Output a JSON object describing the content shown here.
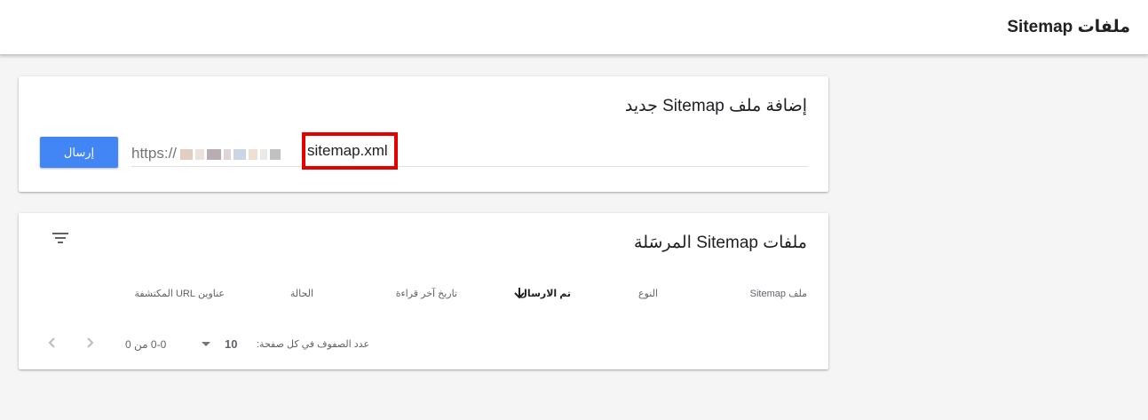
{
  "header": {
    "title": "ملفات Sitemap"
  },
  "add_sitemap": {
    "title": "إضافة ملف Sitemap جديد",
    "url_prefix": "https://",
    "input_value": "sitemap.xml",
    "submit_label": "إرسال"
  },
  "submitted": {
    "title": "ملفات Sitemap المرسَلة",
    "columns": {
      "sitemap": "ملف Sitemap",
      "type": "النوع",
      "submitted": "تم الارسال",
      "last_read": "تاريخ آخر قراءة",
      "status": "الحالة",
      "discovered_urls": "عناوين URL المكتشفة"
    },
    "sorted_column": "submitted",
    "rows": [],
    "pagination": {
      "rows_per_page_label": "عدد الصفوف في كل صفحة:",
      "rows_per_page": "10",
      "range": "0-0 من 0"
    }
  },
  "colors": {
    "primary": "#4285f4",
    "highlight": "#e50000"
  },
  "icons": [
    "filter-icon",
    "arrow-down-icon",
    "chevron-left-icon",
    "chevron-right-icon",
    "dropdown-caret-icon"
  ]
}
